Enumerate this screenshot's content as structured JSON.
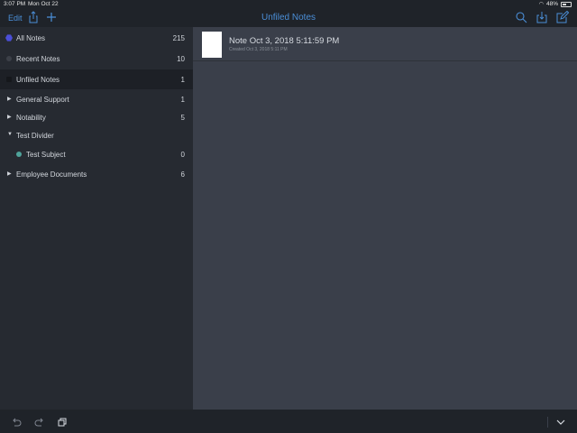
{
  "status": {
    "time": "3:07 PM",
    "date": "Mon Oct 22",
    "battery": "48%"
  },
  "nav": {
    "edit_label": "Edit",
    "title": "Unfiled Notes",
    "icons": [
      "share-icon",
      "add-icon",
      "search-icon",
      "import-icon",
      "compose-icon"
    ],
    "accent_color": "#4b8fd8"
  },
  "sidebar": {
    "items": [
      {
        "label": "All Notes",
        "count": "215",
        "icon": "hexagon-icon"
      },
      {
        "label": "Recent Notes",
        "count": "10",
        "icon": "clock-icon"
      },
      {
        "label": "Unfiled Notes",
        "count": "1",
        "icon": "unfiled-icon",
        "selected": true
      },
      {
        "label": "General Support",
        "count": "1",
        "icon": "collapsed-triangle-icon"
      },
      {
        "label": "Notability",
        "count": "5",
        "icon": "collapsed-triangle-icon"
      },
      {
        "label": "Test Divider",
        "count": "",
        "icon": "expanded-triangle-icon"
      },
      {
        "label": "Test Subject",
        "count": "0",
        "icon": "subject-dot-icon"
      },
      {
        "label": "Employee Documents",
        "count": "6",
        "icon": "collapsed-triangle-icon"
      }
    ]
  },
  "notes": [
    {
      "title": "Note Oct 3, 2018 5:11:59 PM",
      "subtitle": "Created Oct 3, 2018 5:11 PM"
    }
  ],
  "bottom": {
    "icons": [
      "undo-icon",
      "redo-icon",
      "copy-icon",
      "chevron-down-icon"
    ]
  }
}
